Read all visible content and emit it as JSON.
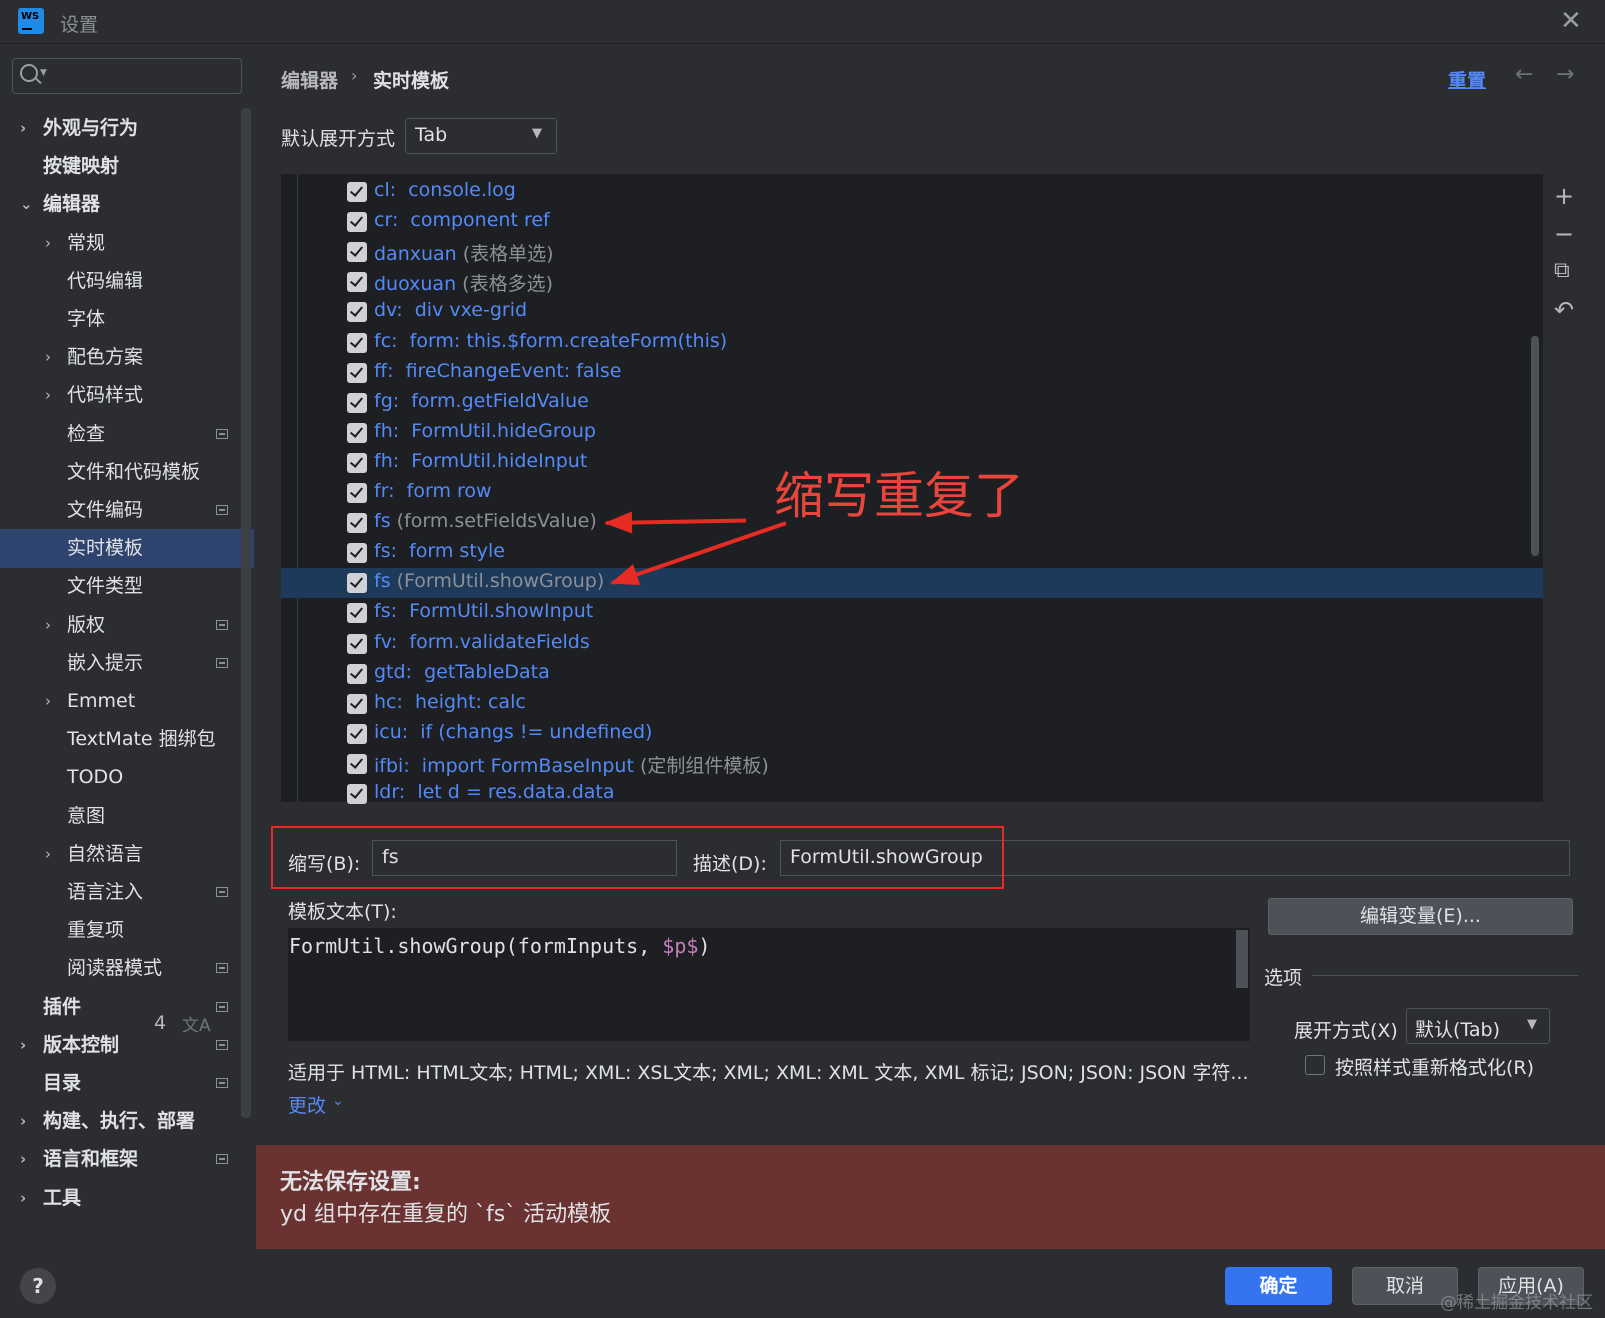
{
  "window": {
    "title": "设置",
    "logo_text": "WS"
  },
  "sidebar": {
    "items": [
      {
        "label": "外观与行为",
        "chevron": "›",
        "bold": true,
        "level": 0,
        "pinned": false
      },
      {
        "label": "按键映射",
        "chevron": "",
        "bold": true,
        "level": 0,
        "pinned": false
      },
      {
        "label": "编辑器",
        "chevron": "⌄",
        "bold": true,
        "level": 0,
        "pinned": false
      },
      {
        "label": "常规",
        "chevron": "›",
        "bold": false,
        "level": 1,
        "pinned": false
      },
      {
        "label": "代码编辑",
        "chevron": "",
        "bold": false,
        "level": 1,
        "pinned": false
      },
      {
        "label": "字体",
        "chevron": "",
        "bold": false,
        "level": 1,
        "pinned": false
      },
      {
        "label": "配色方案",
        "chevron": "›",
        "bold": false,
        "level": 1,
        "pinned": false
      },
      {
        "label": "代码样式",
        "chevron": "›",
        "bold": false,
        "level": 1,
        "pinned": false
      },
      {
        "label": "检查",
        "chevron": "",
        "bold": false,
        "level": 1,
        "pinned": true
      },
      {
        "label": "文件和代码模板",
        "chevron": "",
        "bold": false,
        "level": 1,
        "pinned": false
      },
      {
        "label": "文件编码",
        "chevron": "",
        "bold": false,
        "level": 1,
        "pinned": true
      },
      {
        "label": "实时模板",
        "chevron": "",
        "bold": false,
        "level": 1,
        "pinned": false,
        "selected": true
      },
      {
        "label": "文件类型",
        "chevron": "",
        "bold": false,
        "level": 1,
        "pinned": false
      },
      {
        "label": "版权",
        "chevron": "›",
        "bold": false,
        "level": 1,
        "pinned": true
      },
      {
        "label": "嵌入提示",
        "chevron": "",
        "bold": false,
        "level": 1,
        "pinned": true
      },
      {
        "label": "Emmet",
        "chevron": "›",
        "bold": false,
        "level": 1,
        "pinned": false
      },
      {
        "label": "TextMate 捆绑包",
        "chevron": "",
        "bold": false,
        "level": 1,
        "pinned": false
      },
      {
        "label": "TODO",
        "chevron": "",
        "bold": false,
        "level": 1,
        "pinned": false
      },
      {
        "label": "意图",
        "chevron": "",
        "bold": false,
        "level": 1,
        "pinned": false
      },
      {
        "label": "自然语言",
        "chevron": "›",
        "bold": false,
        "level": 1,
        "pinned": false
      },
      {
        "label": "语言注入",
        "chevron": "",
        "bold": false,
        "level": 1,
        "pinned": true
      },
      {
        "label": "重复项",
        "chevron": "",
        "bold": false,
        "level": 1,
        "pinned": false
      },
      {
        "label": "阅读器模式",
        "chevron": "",
        "bold": false,
        "level": 1,
        "pinned": true
      },
      {
        "label": "插件",
        "chevron": "",
        "bold": true,
        "level": 0,
        "pinned": true
      },
      {
        "label": "版本控制",
        "chevron": "›",
        "bold": true,
        "level": 0,
        "pinned": true
      },
      {
        "label": "目录",
        "chevron": "",
        "bold": true,
        "level": 0,
        "pinned": true
      },
      {
        "label": "构建、执行、部署",
        "chevron": "›",
        "bold": true,
        "level": 0,
        "pinned": false
      },
      {
        "label": "语言和框架",
        "chevron": "›",
        "bold": true,
        "level": 0,
        "pinned": true
      },
      {
        "label": "工具",
        "chevron": "›",
        "bold": true,
        "level": 0,
        "pinned": false
      }
    ],
    "plugins_count": "4",
    "translate_icon": "文A",
    "help_label": "?"
  },
  "header": {
    "breadcrumb": [
      "编辑器",
      "实时模板"
    ],
    "separator": "›",
    "reset_label": "重置",
    "back_icon": "←",
    "forward_icon": "→"
  },
  "default_expand": {
    "label": "默认展开方式",
    "value": "Tab",
    "arrow": "▼"
  },
  "templates": [
    {
      "abbr": "cl",
      "sep": ":  ",
      "text": "console.log",
      "desc": ""
    },
    {
      "abbr": "cr",
      "sep": ":  ",
      "text": "component ref",
      "desc": ""
    },
    {
      "abbr": "danxuan",
      "sep": " ",
      "text": "",
      "desc": "(表格单选)"
    },
    {
      "abbr": "duoxuan",
      "sep": " ",
      "text": "",
      "desc": "(表格多选)"
    },
    {
      "abbr": "dv",
      "sep": ":  ",
      "text": "div vxe-grid",
      "desc": ""
    },
    {
      "abbr": "fc",
      "sep": ":  ",
      "text": "form: this.$form.createForm(this)",
      "desc": ""
    },
    {
      "abbr": "ff",
      "sep": ":  ",
      "text": "fireChangeEvent: false",
      "desc": ""
    },
    {
      "abbr": "fg",
      "sep": ":  ",
      "text": "form.getFieldValue",
      "desc": ""
    },
    {
      "abbr": "fh",
      "sep": ":  ",
      "text": "FormUtil.hideGroup",
      "desc": ""
    },
    {
      "abbr": "fh",
      "sep": ":  ",
      "text": "FormUtil.hideInput",
      "desc": ""
    },
    {
      "abbr": "fr",
      "sep": ":  ",
      "text": "form row",
      "desc": ""
    },
    {
      "abbr": "fs",
      "sep": " ",
      "text": "",
      "desc": "(form.setFieldsValue)"
    },
    {
      "abbr": "fs",
      "sep": ":  ",
      "text": "form style",
      "desc": ""
    },
    {
      "abbr": "fs",
      "sep": " ",
      "text": "",
      "desc": "(FormUtil.showGroup)",
      "selected": true
    },
    {
      "abbr": "fs",
      "sep": ":  ",
      "text": "FormUtil.showInput",
      "desc": ""
    },
    {
      "abbr": "fv",
      "sep": ":  ",
      "text": "form.validateFields",
      "desc": ""
    },
    {
      "abbr": "gtd",
      "sep": ":  ",
      "text": "getTableData",
      "desc": ""
    },
    {
      "abbr": "hc",
      "sep": ":  ",
      "text": "height: calc",
      "desc": ""
    },
    {
      "abbr": "icu",
      "sep": ":  ",
      "text": "if (changs != undefined)",
      "desc": ""
    },
    {
      "abbr": "ifbi",
      "sep": ":  ",
      "text": "import FormBaseInput",
      "desc": " (定制组件模板)"
    },
    {
      "abbr": "ldr",
      "sep": ":  ",
      "text": "let d = res.data.data",
      "desc": ""
    }
  ],
  "toolbar_icons": {
    "add": "+",
    "remove": "−",
    "copy": "⧉",
    "revert": "↶"
  },
  "annotation": {
    "text": "缩写重复了"
  },
  "fields": {
    "abbr_label": "缩写(B):",
    "abbr_value": "fs",
    "desc_label": "描述(D):",
    "desc_value": "FormUtil.showGroup",
    "template_text_label": "模板文本(T):",
    "template_code_prefix": "FormUtil.showGroup(formInputs, ",
    "template_code_var": "$p$",
    "template_code_suffix": ")",
    "edit_vars_label": "编辑变量(E)...",
    "options_label": "选项",
    "expand_mode_label": "展开方式(X)",
    "expand_mode_value": "默认(Tab)",
    "expand_mode_arrow": "▼",
    "reformat_label": "按照样式重新格式化(R)",
    "reformat_checked": false,
    "applies_to": "适用于 HTML: HTML文本; HTML; XML: XSL文本; XML; XML: XML 文本, XML 标记; JSON; JSON: JSON 字符...",
    "change_label": "更改",
    "change_chevron": "⌄"
  },
  "error": {
    "title": "无法保存设置:",
    "message": "yd 组中存在重复的 `fs` 活动模板"
  },
  "buttons": {
    "ok": "确定",
    "cancel": "取消",
    "apply": "应用(A)"
  },
  "watermark": "@稀土掘金技术社区",
  "colors": {
    "accent": "#3574f0",
    "link": "#548af7",
    "selection": "#2e436e",
    "error_bg": "#6b3232",
    "annotation": "#e62b22"
  }
}
